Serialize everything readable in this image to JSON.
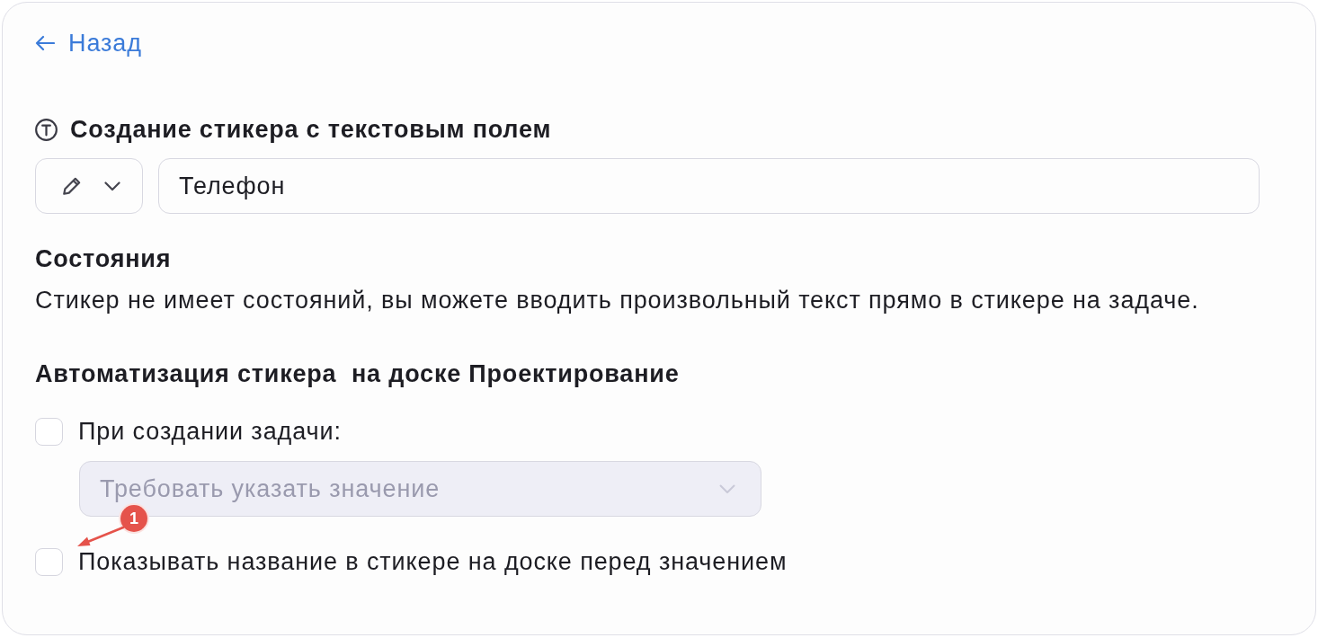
{
  "back_link": {
    "label": "Назад"
  },
  "title": {
    "text": "Создание стикера с текстовым полем"
  },
  "sticker": {
    "value": "Телефон"
  },
  "states_section": {
    "heading": "Состояния",
    "description": "Стикер не имеет состояний, вы можете вводить произвольный текст прямо в стикере на задаче."
  },
  "automation": {
    "heading": "Автоматизация стикера  на доске Проектирование",
    "options": [
      {
        "label": "При создании задачи:",
        "checked": false,
        "select": {
          "value": "Требовать указать значение",
          "disabled": true
        }
      },
      {
        "label": "Показывать название в стикере на доске перед значением",
        "checked": false
      }
    ]
  },
  "annotation": {
    "label": "1"
  }
}
